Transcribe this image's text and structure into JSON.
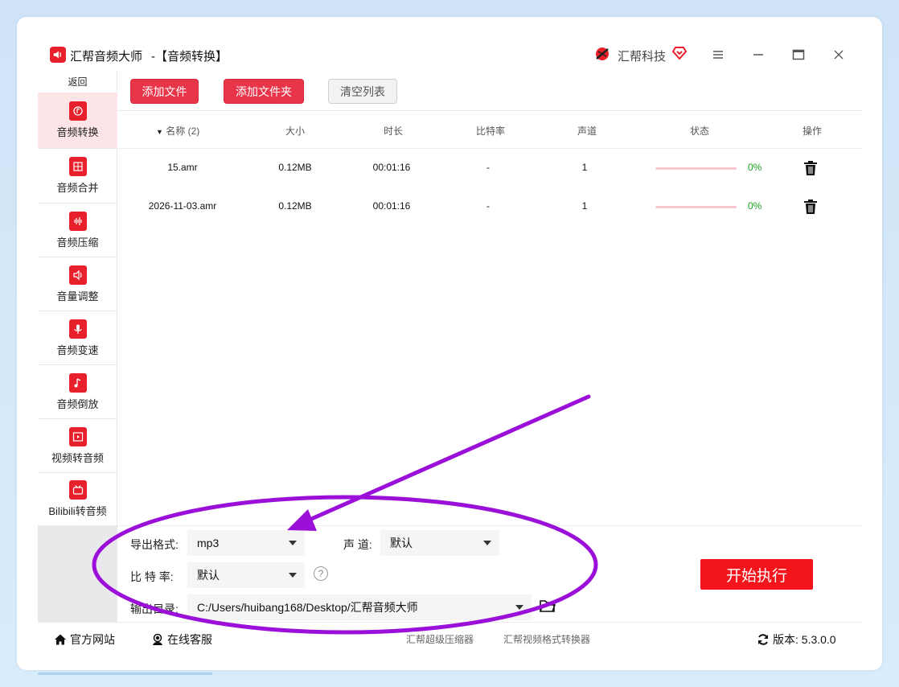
{
  "window": {
    "app_name": "汇帮音频大师",
    "subtitle": "-【音频转换】",
    "brand": "汇帮科技"
  },
  "sidebar": {
    "back": "返回",
    "items": [
      {
        "label": "音频转换",
        "icon": "audio-convert-icon",
        "active": true
      },
      {
        "label": "音频合并",
        "icon": "audio-merge-icon"
      },
      {
        "label": "音频压缩",
        "icon": "audio-compress-icon"
      },
      {
        "label": "音量调整",
        "icon": "volume-icon"
      },
      {
        "label": "音频变速",
        "icon": "mic-icon"
      },
      {
        "label": "音频倒放",
        "icon": "music-note-icon"
      },
      {
        "label": "视频转音频",
        "icon": "film-icon"
      },
      {
        "label": "Bilibili转音频",
        "icon": "tv-icon"
      }
    ]
  },
  "toolbar": {
    "add_file": "添加文件",
    "add_folder": "添加文件夹",
    "clear_list": "清空列表"
  },
  "table": {
    "headers": {
      "name": "名称 (2)",
      "size": "大小",
      "duration": "时长",
      "bitrate": "比特率",
      "channels": "声道",
      "status": "状态",
      "action": "操作"
    },
    "rows": [
      {
        "name": "15.amr",
        "size": "0.12MB",
        "duration": "00:01:16",
        "bitrate": "-",
        "channels": "1",
        "progress": "0%"
      },
      {
        "name": "2026-11-03.amr",
        "size": "0.12MB",
        "duration": "00:01:16",
        "bitrate": "-",
        "channels": "1",
        "progress": "0%"
      }
    ]
  },
  "settings": {
    "format_label": "导出格式:",
    "format_value": "mp3",
    "channel_label": "声 道:",
    "channel_value": "默认",
    "bitrate_label": "比 特 率:",
    "bitrate_value": "默认",
    "help": "?",
    "output_label": "输出目录:",
    "output_value": "C:/Users/huibang168/Desktop/汇帮音频大师",
    "start": "开始执行"
  },
  "footer": {
    "website": "官方网站",
    "support": "在线客服",
    "link1": "汇帮超级压缩器",
    "link2": "汇帮视频格式转换器",
    "version": "版本: 5.3.0.0"
  },
  "colors": {
    "accent": "#e8202c",
    "button_red": "#e8354a",
    "annotation": "#9b10d8"
  }
}
